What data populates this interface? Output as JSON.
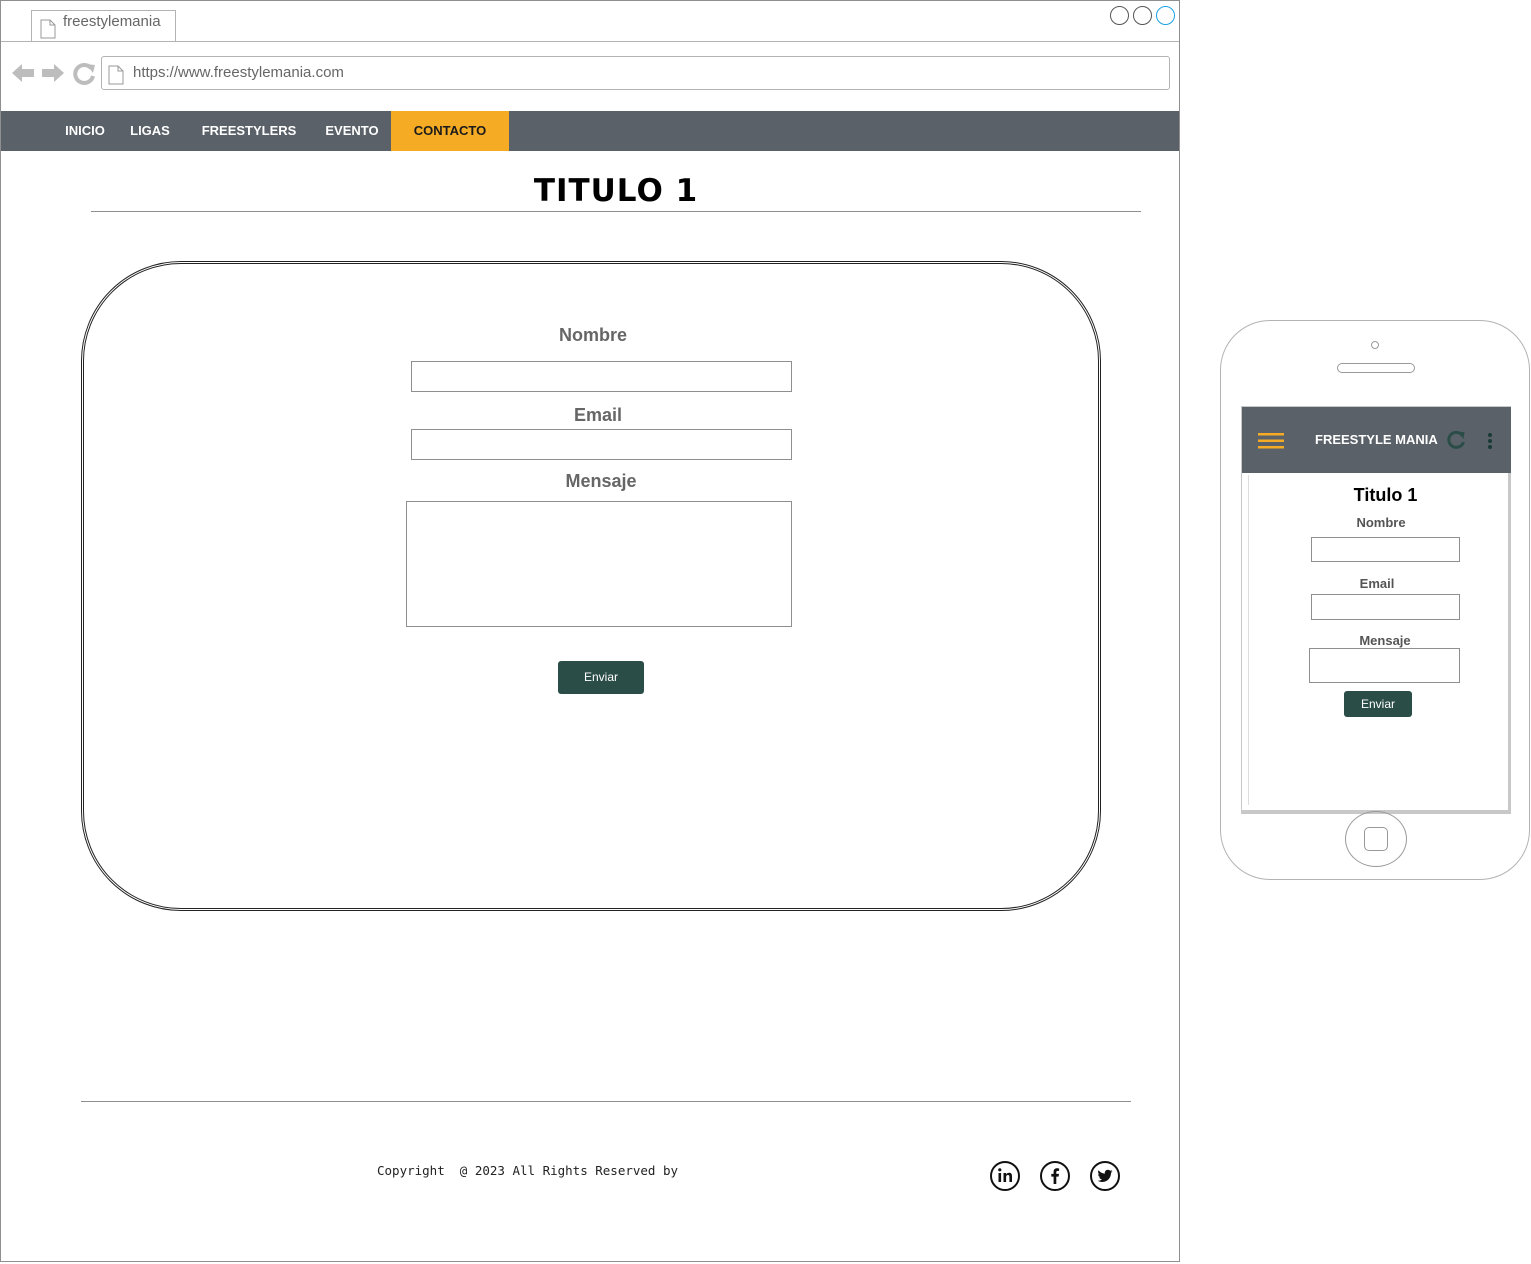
{
  "browser": {
    "tab_title": "freestylemania",
    "url": "https://www.freestylemania.com"
  },
  "nav": {
    "items": [
      {
        "label": "INICIO"
      },
      {
        "label": "LIGAS"
      },
      {
        "label": "FREESTYLERS"
      },
      {
        "label": "EVENTO"
      },
      {
        "label": "CONTACTO"
      }
    ],
    "active_item": "CONTACTO"
  },
  "page": {
    "title": "TITULO 1"
  },
  "form": {
    "name_label": "Nombre",
    "email_label": "Email",
    "message_label": "Mensaje",
    "submit_label": "Enviar"
  },
  "footer": {
    "copyright": "Copyright  @ 2023 All Rights Reserved by",
    "social": [
      "linkedin-icon",
      "facebook-icon",
      "twitter-icon"
    ]
  },
  "mobile": {
    "app_title": "FREESTYLE MANIA",
    "title": "Titulo 1",
    "name_label": "Nombre",
    "email_label": "Email",
    "message_label": "Mensaje",
    "submit_label": "Enviar"
  },
  "colors": {
    "navbar": "#5a6168",
    "accent": "#f5ab24",
    "button": "#2b4d48",
    "maximize": "#1ba1e2"
  }
}
